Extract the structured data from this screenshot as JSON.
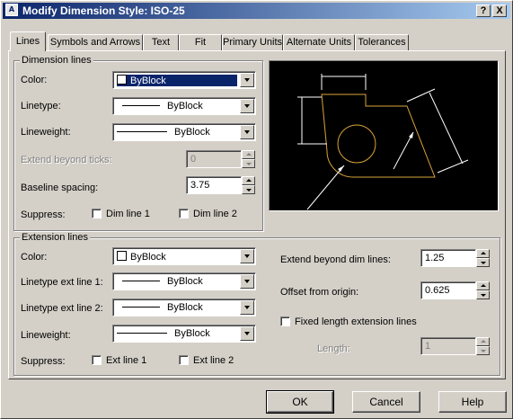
{
  "window": {
    "title": "Modify Dimension Style: ISO-25",
    "help_btn": "?",
    "close_btn": "X",
    "app_icon": "autocad-icon"
  },
  "tabs": [
    "Lines",
    "Symbols and Arrows",
    "Text",
    "Fit",
    "Primary Units",
    "Alternate Units",
    "Tolerances"
  ],
  "dimension_lines": {
    "legend": "Dimension lines",
    "color_label": "Color:",
    "color_value": "ByBlock",
    "linetype_label": "Linetype:",
    "linetype_value": "ByBlock",
    "lineweight_label": "Lineweight:",
    "lineweight_value": "ByBlock",
    "extend_label": "Extend beyond ticks:",
    "extend_value": "0",
    "baseline_label": "Baseline spacing:",
    "baseline_value": "3.75",
    "suppress_label": "Suppress:",
    "dimline1": "Dim line 1",
    "dimline2": "Dim line 2"
  },
  "extension_lines": {
    "legend": "Extension lines",
    "color_label": "Color:",
    "color_value": "ByBlock",
    "linetype1_label": "Linetype ext line 1:",
    "linetype1_value": "ByBlock",
    "linetype2_label": "Linetype ext line 2:",
    "linetype2_value": "ByBlock",
    "lineweight_label": "Lineweight:",
    "lineweight_value": "ByBlock",
    "suppress_label": "Suppress:",
    "extline1": "Ext line 1",
    "extline2": "Ext line 2",
    "extend_beyond_label": "Extend beyond dim lines:",
    "extend_beyond_value": "1.25",
    "offset_label": "Offset from origin:",
    "offset_value": "0.625",
    "fixed_length_label": "Fixed length extension lines",
    "length_label": "Length:",
    "length_value": "1"
  },
  "buttons": {
    "ok": "OK",
    "cancel": "Cancel",
    "help": "Help"
  },
  "colors": {
    "title_start": "#0a246a",
    "title_end": "#a6caf0",
    "preview_bg": "#000000",
    "preview_geometry": "#d9a33a",
    "preview_dims": "#ffffff"
  }
}
